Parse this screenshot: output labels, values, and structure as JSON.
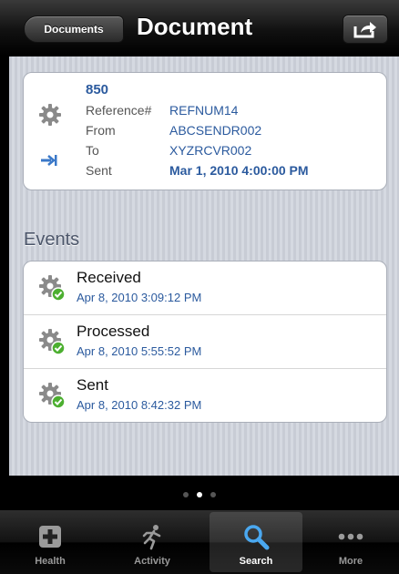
{
  "nav": {
    "back_label": "Documents",
    "title": "Document"
  },
  "document": {
    "number": "850",
    "rows": [
      {
        "label": "Reference#",
        "value": "REFNUM14"
      },
      {
        "label": "From",
        "value": "ABCSENDR002"
      },
      {
        "label": "To",
        "value": "XYZRCVR002"
      },
      {
        "label": "Sent",
        "value": "Mar 1, 2010 4:00:00 PM"
      }
    ]
  },
  "events": {
    "heading": "Events",
    "items": [
      {
        "title": "Received",
        "time": "Apr 8, 2010 3:09:12 PM"
      },
      {
        "title": "Processed",
        "time": "Apr 8, 2010 5:55:52 PM"
      },
      {
        "title": "Sent",
        "time": "Apr 8, 2010 8:42:32 PM"
      }
    ]
  },
  "page_indicator": {
    "count": 3,
    "active": 2
  },
  "tabs": [
    {
      "label": "Health",
      "icon": "plus-icon"
    },
    {
      "label": "Activity",
      "icon": "runner-icon"
    },
    {
      "label": "Search",
      "icon": "search-icon",
      "selected": true
    },
    {
      "label": "More",
      "icon": "more-icon"
    }
  ],
  "colors": {
    "accent_blue": "#2b5a9e",
    "check_green": "#4caf30"
  }
}
